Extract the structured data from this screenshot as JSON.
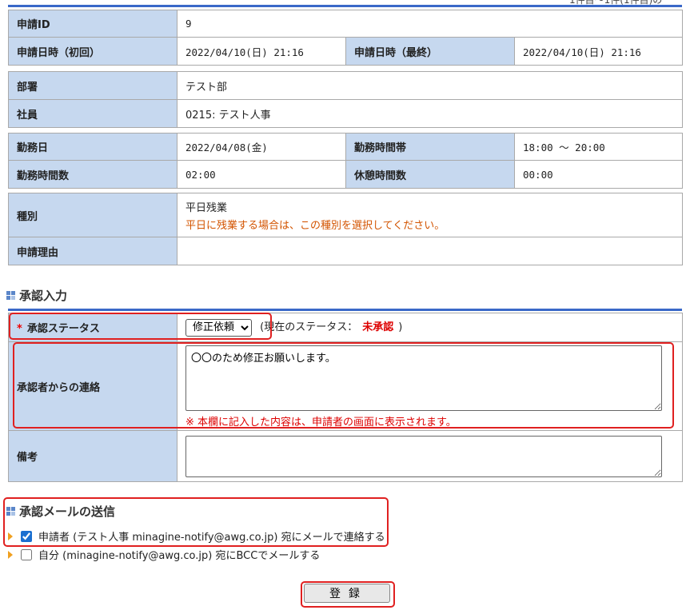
{
  "top_fragment": "1件目～1件(1件目)の",
  "request": {
    "id_label": "申請ID",
    "id_value": "9",
    "first_date_label": "申請日時（初回）",
    "first_date_value": "2022/04/10(日) 21:16",
    "last_date_label": "申請日時（最終）",
    "last_date_value": "2022/04/10(日) 21:16"
  },
  "person": {
    "dept_label": "部署",
    "dept_value": "テスト部",
    "employee_label": "社員",
    "employee_value": "0215: テスト人事"
  },
  "work": {
    "date_label": "勤務日",
    "date_value": "2022/04/08(金)",
    "timeband_label": "勤務時間帯",
    "timeband_value": "18:00 ～ 20:00",
    "hours_label": "勤務時間数",
    "hours_value": "02:00",
    "break_label": "休憩時間数",
    "break_value": "00:00"
  },
  "type": {
    "type_label": "種別",
    "type_value": "平日残業",
    "type_note": "平日に残業する場合は、この種別を選択してください。",
    "reason_label": "申請理由",
    "reason_value": ""
  },
  "approval": {
    "section_title": "承認入力",
    "required_mark": "*",
    "status_label": "承認ステータス",
    "status_selected": "修正依頼",
    "current_status_prefix": "(現在のステータス：",
    "current_status_value": "未承認",
    "current_status_suffix": ")",
    "message_label": "承認者からの連絡",
    "message_value": "〇〇のため修正お願いします。",
    "message_note": "※ 本欄に記入した内容は、申請者の画面に表示されます。",
    "remarks_label": "備考",
    "remarks_value": ""
  },
  "mail": {
    "section_title": "承認メールの送信",
    "applicant_text": "申請者 (テスト人事 minagine-notify@awg.co.jp) 宛にメールで連絡する",
    "applicant_checked": true,
    "self_text": "自分 (minagine-notify@awg.co.jp) 宛にBCCでメールする",
    "self_checked": false
  },
  "submit_label": "登録",
  "colors": {
    "header_blue": "#3a68c8",
    "label_bg": "#c6d8ef",
    "highlight_red": "#e02020",
    "note_orange": "#d35400"
  }
}
